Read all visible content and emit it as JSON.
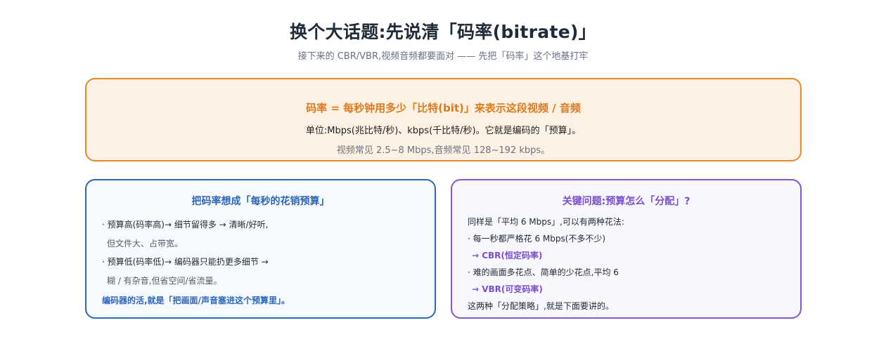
{
  "header": {
    "title": "换个大话题:先说清「码率(bitrate)」",
    "subtitle": "接下来的 CBR/VBR,视频音频都要面对 —— 先把「码率」这个地基打牢"
  },
  "definition": {
    "headline": "码率 = 每秒钟用多少「比特(bit)」来表示这段视频 / 音频",
    "units": "单位:Mbps(兆比特/秒)、kbps(千比特/秒)。它就是编码的「预算」。",
    "typical": "视频常见 2.5~8 Mbps,音频常见 128~192 kbps。"
  },
  "budget_card": {
    "title": "把码率想成「每秒的花销预算」",
    "lines": [
      "· 预算高(码率高)→ 细节留得多 → 清晰/好听,",
      "  但文件大、占带宽。",
      "· 预算低(码率低)→ 编码器只能扔更多细节 →",
      "  糊 / 有杂音,但省空间/省流量。"
    ],
    "conclusion": "编码器的活,就是「把画面/声音塞进这个预算里」。"
  },
  "question_card": {
    "title": "关键问题:预算怎么「分配」?",
    "intro": "同样是「平均 6 Mbps」,可以有两种花法:",
    "option1": "· 每一秒都严格花 6 Mbps(不多不少)",
    "option1_result": "→ CBR(恒定码率)",
    "option2": "· 难的画面多花点、简单的少花点,平均 6",
    "option2_result": "→ VBR(可变码率)",
    "footer": "这两种「分配策略」,就是下面要讲的。"
  }
}
